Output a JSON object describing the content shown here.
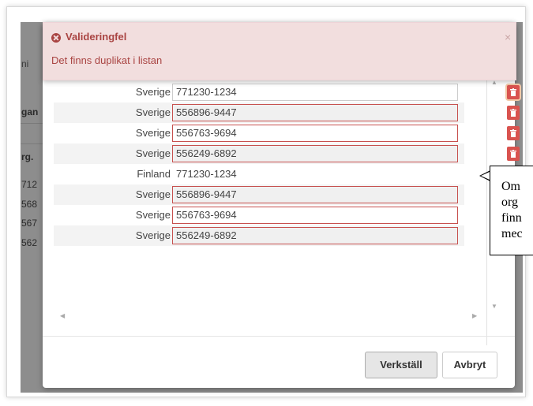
{
  "background": {
    "fragments": [
      "ni",
      "gan",
      "rg.",
      "712",
      "568",
      "567",
      "562"
    ]
  },
  "toast": {
    "title": "Valideringfel",
    "message": "Det finns duplikat i listan",
    "close": "×",
    "color": "#a94442"
  },
  "rows": [
    {
      "country": "Sverige",
      "org_nr": "771230-1234",
      "error": false
    },
    {
      "country": "Sverige",
      "org_nr": "556896-9447",
      "error": true
    },
    {
      "country": "Sverige",
      "org_nr": "556763-9694",
      "error": true
    },
    {
      "country": "Sverige",
      "org_nr": "556249-6892",
      "error": true
    },
    {
      "country": "Finland",
      "org_nr": "771230-1234",
      "error": false
    },
    {
      "country": "Sverige",
      "org_nr": "556896-9447",
      "error": true
    },
    {
      "country": "Sverige",
      "org_nr": "556763-9694",
      "error": true
    },
    {
      "country": "Sverige",
      "org_nr": "556249-6892",
      "error": true
    }
  ],
  "buttons": {
    "apply": "Verkställ",
    "cancel": "Avbryt"
  },
  "callout": {
    "lines": [
      "Om",
      "org",
      "finn",
      "mec"
    ]
  },
  "colors": {
    "danger": "#d9534f",
    "error_border": "#c7514f"
  }
}
